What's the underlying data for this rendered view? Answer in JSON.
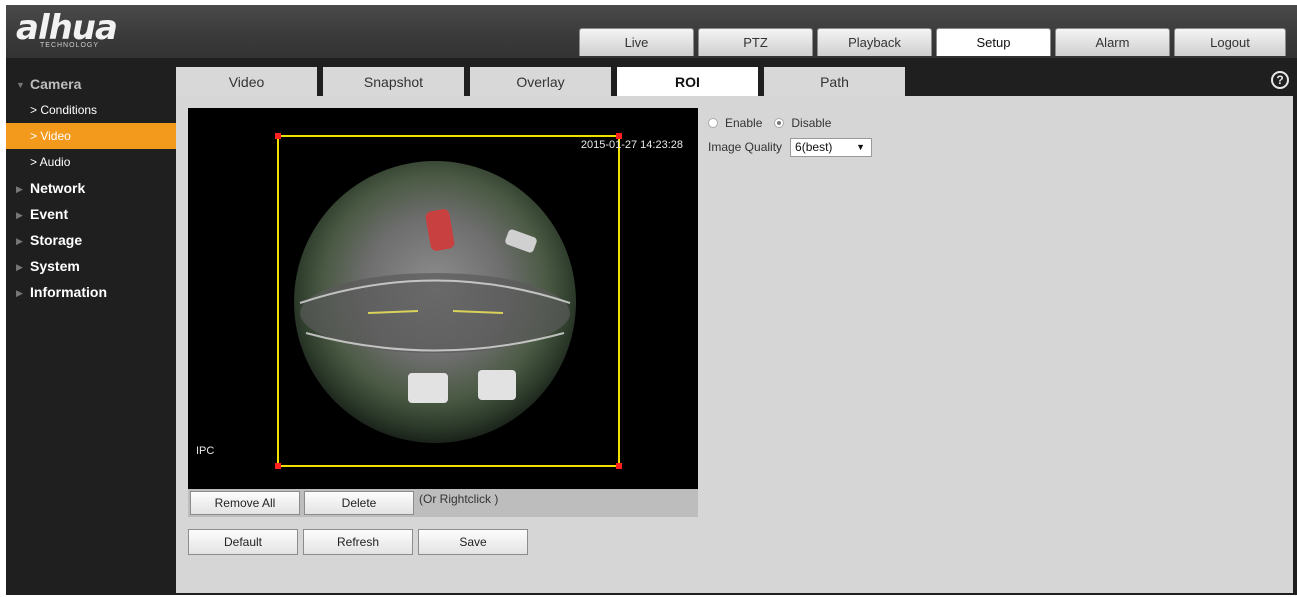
{
  "logo": {
    "text": "alhua",
    "subtext": "TECHNOLOGY"
  },
  "topnav": [
    "Live",
    "PTZ",
    "Playback",
    "Setup",
    "Alarm",
    "Logout"
  ],
  "sidebar": {
    "camera": "Camera",
    "sub": [
      "> Conditions",
      "> Video",
      "> Audio"
    ],
    "items": [
      "Network",
      "Event",
      "Storage",
      "System",
      "Information"
    ]
  },
  "subtabs": [
    "Video",
    "Snapshot",
    "Overlay",
    "ROI",
    "Path"
  ],
  "video": {
    "timestamp": "2015-01-27 14:23:28",
    "label": "IPC"
  },
  "roi_buttons": {
    "remove_all": "Remove All",
    "delete": "Delete",
    "hint": "(Or Rightclick )"
  },
  "actions": {
    "default": "Default",
    "refresh": "Refresh",
    "save": "Save"
  },
  "options": {
    "enable": "Enable",
    "disable": "Disable",
    "selected": "disable",
    "image_quality_label": "Image Quality",
    "image_quality_value": "6(best)"
  },
  "colors": {
    "accent": "#f39a1d",
    "roi_box": "#f0e000",
    "roi_corner": "#ff2020"
  }
}
